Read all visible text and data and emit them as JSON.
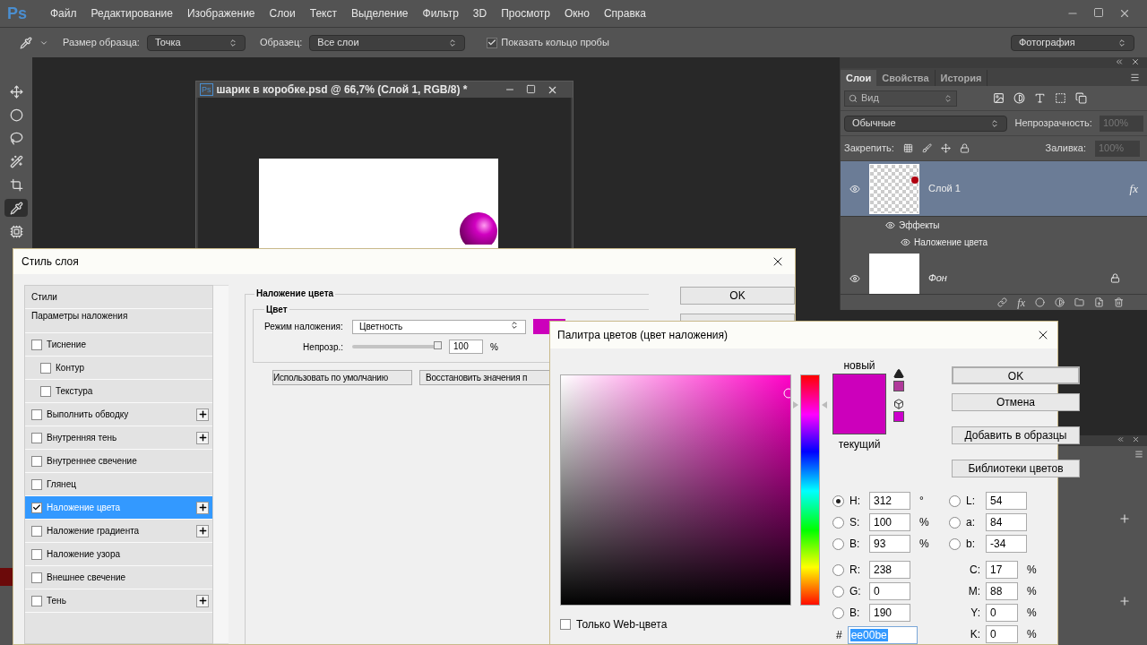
{
  "app": {
    "logo": "Ps"
  },
  "menu": [
    "Файл",
    "Редактирование",
    "Изображение",
    "Слои",
    "Текст",
    "Выделение",
    "Фильтр",
    "3D",
    "Просмотр",
    "Окно",
    "Справка"
  ],
  "options_bar": {
    "sample_size_label": "Размер образца:",
    "sample_size": "Точка",
    "sample_label": "Образец:",
    "sample": "Все слои",
    "show_ring": {
      "label": "Показать кольцо пробы",
      "checked": true
    },
    "workspace": "Фотография"
  },
  "tools": [
    {
      "kind": "move",
      "selected": false
    },
    {
      "kind": "marquee",
      "selected": false
    },
    {
      "kind": "lasso",
      "selected": false
    },
    {
      "kind": "wand",
      "selected": false
    },
    {
      "kind": "crop",
      "selected": false
    },
    {
      "kind": "eyedropper",
      "selected": true
    },
    {
      "kind": "chip",
      "selected": false
    }
  ],
  "document": {
    "badge": "Ps",
    "title": "шарик в коробке.psd @ 66,7% (Слой 1, RGB/8) *"
  },
  "layers_panel": {
    "tabs": [
      {
        "label": "Слои",
        "selected": true
      },
      {
        "label": "Свойства",
        "selected": false
      },
      {
        "label": "История",
        "selected": false
      }
    ],
    "filter": "Вид",
    "blend_mode": "Обычные",
    "opacity_label": "Непрозрачность:",
    "opacity": "100%",
    "lock_label": "Закрепить:",
    "fill_label": "Заливка:",
    "fill": "100%",
    "layers": [
      {
        "name": "Слой 1",
        "kind": "transparent",
        "selected": true,
        "visible": true,
        "badge": "fx",
        "locked": false,
        "children": [
          {
            "name": "Эффекты",
            "visible": true
          },
          {
            "name": "Наложение цвета",
            "visible": true
          }
        ]
      },
      {
        "name": "Фон",
        "kind": "background",
        "selected": false,
        "visible": true,
        "locked": true
      }
    ],
    "footer_fx": "fx"
  },
  "layer_style": {
    "title": "Стиль слоя",
    "styles": [
      {
        "label": "Стили",
        "kind": "header"
      },
      {
        "label": "Параметры наложения",
        "kind": "header"
      },
      {
        "label": "Тиснение",
        "kind": "option",
        "checked": false,
        "selected": false,
        "plus": false
      },
      {
        "label": "Контур",
        "kind": "sub",
        "checked": false,
        "selected": false,
        "plus": false
      },
      {
        "label": "Текстура",
        "kind": "sub",
        "checked": false,
        "selected": false,
        "plus": false
      },
      {
        "label": "Выполнить обводку",
        "kind": "option",
        "checked": false,
        "selected": false,
        "plus": true
      },
      {
        "label": "Внутренняя тень",
        "kind": "option",
        "checked": false,
        "selected": false,
        "plus": true
      },
      {
        "label": "Внутреннее свечение",
        "kind": "option",
        "checked": false,
        "selected": false,
        "plus": false
      },
      {
        "label": "Глянец",
        "kind": "option",
        "checked": false,
        "selected": false,
        "plus": false
      },
      {
        "label": "Наложение цвета",
        "kind": "option",
        "checked": true,
        "selected": true,
        "plus": true
      },
      {
        "label": "Наложение градиента",
        "kind": "option",
        "checked": false,
        "selected": false,
        "plus": true
      },
      {
        "label": "Наложение узора",
        "kind": "option",
        "checked": false,
        "selected": false,
        "plus": false
      },
      {
        "label": "Внешнее свечение",
        "kind": "option",
        "checked": false,
        "selected": false,
        "plus": false
      },
      {
        "label": "Тень",
        "kind": "option",
        "checked": false,
        "selected": false,
        "plus": true
      }
    ],
    "section_title": "Наложение цвета",
    "group_title": "Цвет",
    "blend_label": "Режим наложения:",
    "blend": "Цветность",
    "color": "#cc00bb",
    "opacity_label": "Непрозр.:",
    "opacity_slider": {
      "level": 1
    },
    "opacity": "100",
    "percent": "%",
    "buttons": [
      "Использовать по умолчанию",
      "Восстановить значения п"
    ],
    "ok": "OK"
  },
  "color_picker": {
    "title": "Палитра цветов (цвет наложения)",
    "new_label": "новый",
    "current_label": "текущий",
    "buttons": [
      "OK",
      "Отмена",
      "Добавить в образцы",
      "Библиотеки цветов"
    ],
    "left_fields": [
      {
        "label": "H:",
        "value": "312",
        "unit": "°",
        "selected": true
      },
      {
        "label": "S:",
        "value": "100",
        "unit": "%",
        "selected": false
      },
      {
        "label": "B:",
        "value": "93",
        "unit": "%",
        "selected": false
      },
      {
        "label": "R:",
        "value": "238",
        "selected": false
      },
      {
        "label": "G:",
        "value": "0",
        "selected": false
      },
      {
        "label": "B:",
        "value": "190",
        "selected": false
      }
    ],
    "lab_fields": [
      {
        "label": "L:",
        "value": "54",
        "selected": false
      },
      {
        "label": "a:",
        "value": "84",
        "selected": false
      },
      {
        "label": "b:",
        "value": "-34",
        "selected": false
      }
    ],
    "cmyk_fields": [
      {
        "label": "C:",
        "value": "17",
        "unit": "%"
      },
      {
        "label": "M:",
        "value": "88",
        "unit": "%"
      },
      {
        "label": "Y:",
        "value": "0",
        "unit": "%"
      },
      {
        "label": "K:",
        "value": "0",
        "unit": "%"
      }
    ],
    "hex_label": "#",
    "hex": "ee00be",
    "web_only": {
      "label": "Только Web-цвета",
      "checked": false
    }
  }
}
